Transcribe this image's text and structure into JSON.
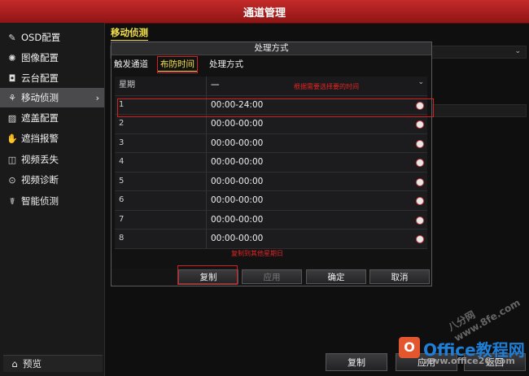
{
  "window": {
    "title": "通道管理"
  },
  "sidebar": {
    "items": [
      {
        "icon": "pencil-icon",
        "label": "OSD配置"
      },
      {
        "icon": "image-settings-icon",
        "label": "图像配置"
      },
      {
        "icon": "ptz-icon",
        "label": "云台配置"
      },
      {
        "icon": "motion-detect-icon",
        "label": "移动侦测",
        "active": true
      },
      {
        "icon": "mask-icon",
        "label": "遮盖配置"
      },
      {
        "icon": "hand-icon",
        "label": "遮挡报警"
      },
      {
        "icon": "video-loss-icon",
        "label": "视频丢失"
      },
      {
        "icon": "diagnose-icon",
        "label": "视频诊断"
      },
      {
        "icon": "smart-detect-icon",
        "label": "智能侦测"
      }
    ],
    "preview_label": "预览"
  },
  "main": {
    "section_title": "移动侦测"
  },
  "dialog": {
    "title": "处理方式",
    "tabs": [
      "触发通道",
      "布防时间",
      "处理方式"
    ],
    "active_tab": 1,
    "weekday_label": "星期",
    "weekday_value": "一",
    "annotation_top": "根据需要选择要的时间",
    "annotation_bottom": "复制到其他星期日",
    "rows": [
      {
        "no": "1",
        "time": "00:00-24:00"
      },
      {
        "no": "2",
        "time": "00:00-00:00"
      },
      {
        "no": "3",
        "time": "00:00-00:00"
      },
      {
        "no": "4",
        "time": "00:00-00:00"
      },
      {
        "no": "5",
        "time": "00:00-00:00"
      },
      {
        "no": "6",
        "time": "00:00-00:00"
      },
      {
        "no": "7",
        "time": "00:00-00:00"
      },
      {
        "no": "8",
        "time": "00:00-00:00"
      }
    ],
    "buttons": {
      "copy": "复制",
      "apply": "应用",
      "ok": "确定",
      "cancel": "取消"
    }
  },
  "footer": {
    "copy": "复制",
    "apply": "应用",
    "back": "返回"
  },
  "watermark": {
    "logo": "O",
    "brand": "Office教程网",
    "site": "www.office26.com",
    "diag": "八分网 www.8fe.com"
  },
  "colors": {
    "accent": "#f4e04a",
    "titlebar": "#b11f1f",
    "annotation": "#e02525"
  }
}
